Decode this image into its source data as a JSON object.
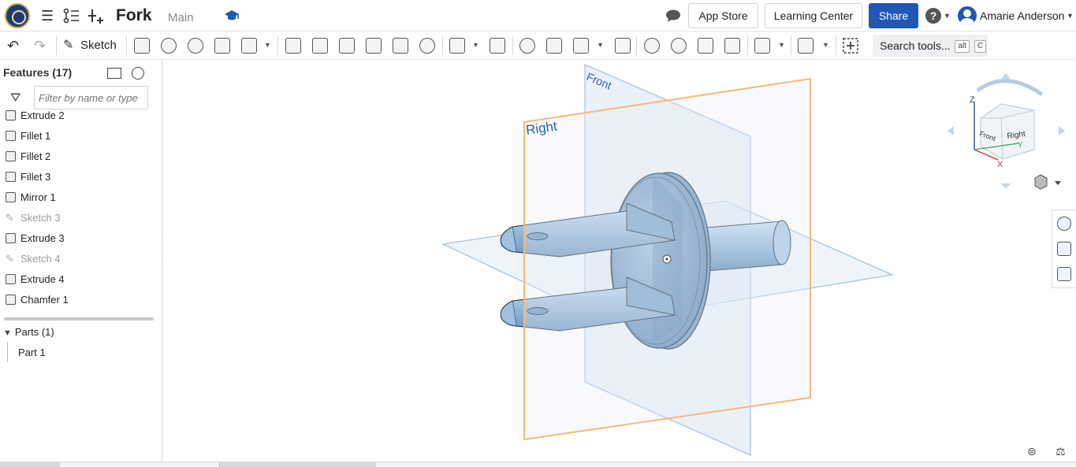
{
  "header": {
    "title": "Fork",
    "branch": "Main",
    "app_store": "App Store",
    "learning_center": "Learning Center",
    "share": "Share",
    "help_symbol": "?",
    "user_name": "Amarie Anderson"
  },
  "toolbar": {
    "sketch_label": "Sketch",
    "search_label": "Search tools...",
    "shortcut_key1": "alt",
    "shortcut_key2": "C"
  },
  "features_panel": {
    "title": "Features (17)",
    "filter_placeholder": "Filter by name or type",
    "items": [
      {
        "label": "Extrude 2",
        "type": "extrude",
        "dim": false
      },
      {
        "label": "Fillet 1",
        "type": "fillet",
        "dim": false
      },
      {
        "label": "Fillet 2",
        "type": "fillet",
        "dim": false
      },
      {
        "label": "Fillet 3",
        "type": "fillet",
        "dim": false
      },
      {
        "label": "Mirror 1",
        "type": "mirror",
        "dim": false
      },
      {
        "label": "Sketch 3",
        "type": "sketch",
        "dim": true
      },
      {
        "label": "Extrude 3",
        "type": "extrude",
        "dim": false
      },
      {
        "label": "Sketch 4",
        "type": "sketch",
        "dim": true
      },
      {
        "label": "Extrude 4",
        "type": "extrude",
        "dim": false
      },
      {
        "label": "Chamfer 1",
        "type": "chamfer",
        "dim": false
      }
    ],
    "parts_header": "Parts (1)",
    "part_name": "Part 1"
  },
  "viewport": {
    "plane_right_label": "Right",
    "plane_front_label": "Front",
    "view_cube": {
      "front": "Front",
      "right": "Right",
      "axis_x": "X",
      "axis_y": "Y",
      "axis_z": "Z"
    }
  },
  "colors": {
    "accent": "#1f57b5",
    "selected_plane": "#f5b97a",
    "plane": "#a9c4e0",
    "part": "#8fb4d6"
  }
}
